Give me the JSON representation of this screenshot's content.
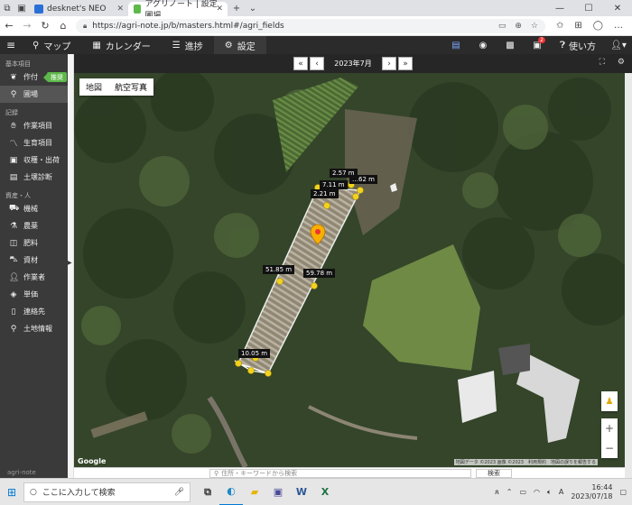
{
  "browser": {
    "tabs": [
      {
        "title": "desknet's NEO",
        "active": false
      },
      {
        "title": "アグリノート | 設定 圃場",
        "active": true
      }
    ],
    "url": "https://agri-note.jp/b/masters.html#/agri_fields"
  },
  "appbar": {
    "nav": [
      {
        "label": "マップ",
        "icon": "map-pin-icon"
      },
      {
        "label": "カレンダー",
        "icon": "calendar-icon"
      },
      {
        "label": "進捗",
        "icon": "list-icon"
      },
      {
        "label": "設定",
        "icon": "gear-icon"
      }
    ],
    "help_label": "使い方",
    "notification_count": "2"
  },
  "sidebar": {
    "sections": [
      {
        "heading": "基本項目",
        "items": [
          {
            "label": "作付",
            "icon": "sprout-icon",
            "badge": "推奨"
          },
          {
            "label": "圃場",
            "icon": "location-pin-icon",
            "active": true
          }
        ]
      },
      {
        "heading": "記録",
        "items": [
          {
            "label": "作業項目",
            "icon": "hand-icon"
          },
          {
            "label": "生育項目",
            "icon": "growth-icon"
          },
          {
            "label": "収穫・出荷",
            "icon": "box-icon"
          },
          {
            "label": "土壌診断",
            "icon": "clipboard-icon"
          }
        ]
      },
      {
        "heading": "資産・人",
        "items": [
          {
            "label": "機械",
            "icon": "tractor-icon"
          },
          {
            "label": "農薬",
            "icon": "flask-icon"
          },
          {
            "label": "肥料",
            "icon": "bag-icon"
          },
          {
            "label": "資材",
            "icon": "cart-icon"
          },
          {
            "label": "作業者",
            "icon": "person-icon"
          },
          {
            "label": "単価",
            "icon": "price-icon"
          },
          {
            "label": "連絡先",
            "icon": "phone-icon"
          },
          {
            "label": "土地情報",
            "icon": "pin-icon"
          }
        ]
      }
    ],
    "logo": "agri-note"
  },
  "calendar": {
    "month": "2023年7月"
  },
  "map": {
    "types": [
      "地図",
      "航空写真"
    ],
    "selected_type": "航空写真",
    "measurements": [
      "2.57 m",
      "…62 m",
      "7.11 m",
      "2.21 m",
      "51.85 m",
      "59.78 m",
      "10.05 m"
    ],
    "provider": "Google",
    "attribution": "地図データ ©2023 画像 ©2023　利用規約　地図の誤りを報告する"
  },
  "bottom_search": {
    "placeholder": "住所・キーワードから検索",
    "button": "検索"
  },
  "taskbar": {
    "search_placeholder": "ここに入力して検索",
    "time": "16:44",
    "date": "2023/07/18"
  }
}
